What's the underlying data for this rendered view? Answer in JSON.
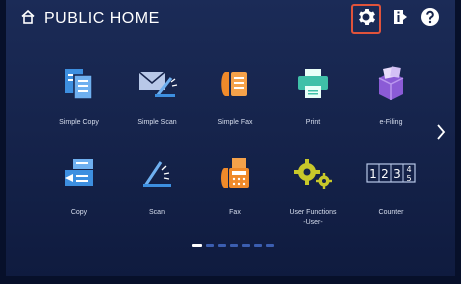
{
  "header": {
    "title": "PUBLIC HOME",
    "icons": [
      "home-icon",
      "settings-icon",
      "info-icon",
      "help-icon"
    ]
  },
  "tiles": [
    {
      "label": "Simple Copy",
      "icon": "simple-copy-icon"
    },
    {
      "label": "Simple Scan",
      "icon": "simple-scan-icon"
    },
    {
      "label": "Simple Fax",
      "icon": "simple-fax-icon"
    },
    {
      "label": "Print",
      "icon": "print-icon"
    },
    {
      "label": "e-Filing",
      "icon": "e-filing-icon"
    },
    {
      "label": "Copy",
      "icon": "copy-icon"
    },
    {
      "label": "Scan",
      "icon": "scan-icon"
    },
    {
      "label": "Fax",
      "icon": "fax-icon"
    },
    {
      "label": "User Functions\n-User-",
      "icon": "user-functions-icon"
    },
    {
      "label": "Counter",
      "icon": "counter-icon"
    }
  ],
  "counter_digits": [
    "1",
    "2",
    "3",
    "4",
    "5"
  ],
  "pager": {
    "pages": 7,
    "current": 1
  },
  "colors": {
    "accent": "#e0533b",
    "tile_blue": "#3d8fe0",
    "tile_orange": "#f08a2a",
    "tile_green": "#3fc0a8",
    "tile_purple": "#8b5bd6",
    "tile_yellow": "#c8c82a"
  }
}
